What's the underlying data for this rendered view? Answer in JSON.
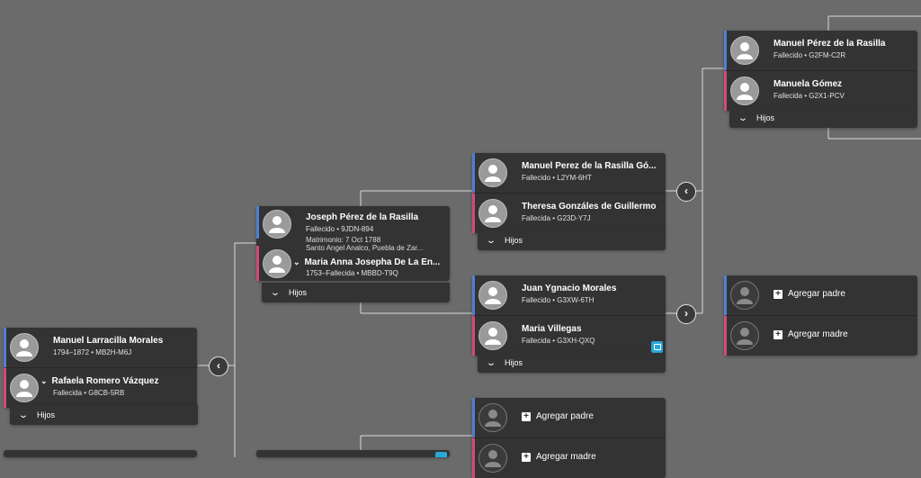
{
  "colors": {
    "background": "#6b6b6b",
    "card": "#333333",
    "male": "#4f7fd1",
    "female": "#d1497c",
    "badge": "#2aa7d6"
  },
  "icons": {
    "avatar": "person-silhouette-icon",
    "expand": "chevron-down-icon",
    "add": "plus-icon",
    "prev": "chevron-left-icon",
    "next": "chevron-right-icon"
  },
  "couple_manuel_larracilla": {
    "husband": {
      "name": "Manuel Larracilla Morales",
      "sub": "1794–1872 • MB2H-M6J"
    },
    "wife": {
      "name": "Rafaela Romero Vázquez",
      "sub": "Fallecida • G8CB-5RB"
    },
    "children_label": "Hijos"
  },
  "couple_joseph": {
    "husband": {
      "name": "Joseph Pérez de la Rasilla",
      "sub": "Fallecido • 9JDN-894"
    },
    "marriage_line1": "Matrimonio: 7 Oct 1788",
    "marriage_line2": "Santo Angel Analco, Puebla de Zar...",
    "wife": {
      "name": "Maria Anna Josepha De La En...",
      "sub": "1753–Fallecida • MBBD-T9Q"
    },
    "children_label": "Hijos"
  },
  "couple_manuel_perez_go": {
    "husband": {
      "name": "Manuel Perez de la Rasilla Gó...",
      "sub": "Fallecido • L2YM-6HT"
    },
    "wife": {
      "name": "Theresa Gonzáles de Guillermo",
      "sub": "Fallecida • G23D-Y7J"
    },
    "children_label": "Hijos"
  },
  "couple_juan": {
    "husband": {
      "name": "Juan Ygnacio Morales",
      "sub": "Fallecido • G3XW-6TH"
    },
    "wife": {
      "name": "Maria Villegas",
      "sub": "Fallecida • G3XH-QXQ"
    },
    "children_label": "Hijos"
  },
  "couple_manuel_perez_rasilla": {
    "husband": {
      "name": "Manuel Pérez de la Rasilla",
      "sub": "Fallecido • G2FM-C2R"
    },
    "wife": {
      "name": "Manuela Gómez",
      "sub": "Fallecida • G2X1-PCV"
    },
    "children_label": "Hijos"
  },
  "add_parents_right": {
    "father_label": "Agregar padre",
    "mother_label": "Agregar madre"
  },
  "add_parents_bottom": {
    "father_label": "Agregar padre",
    "mother_label": "Agregar madre"
  }
}
